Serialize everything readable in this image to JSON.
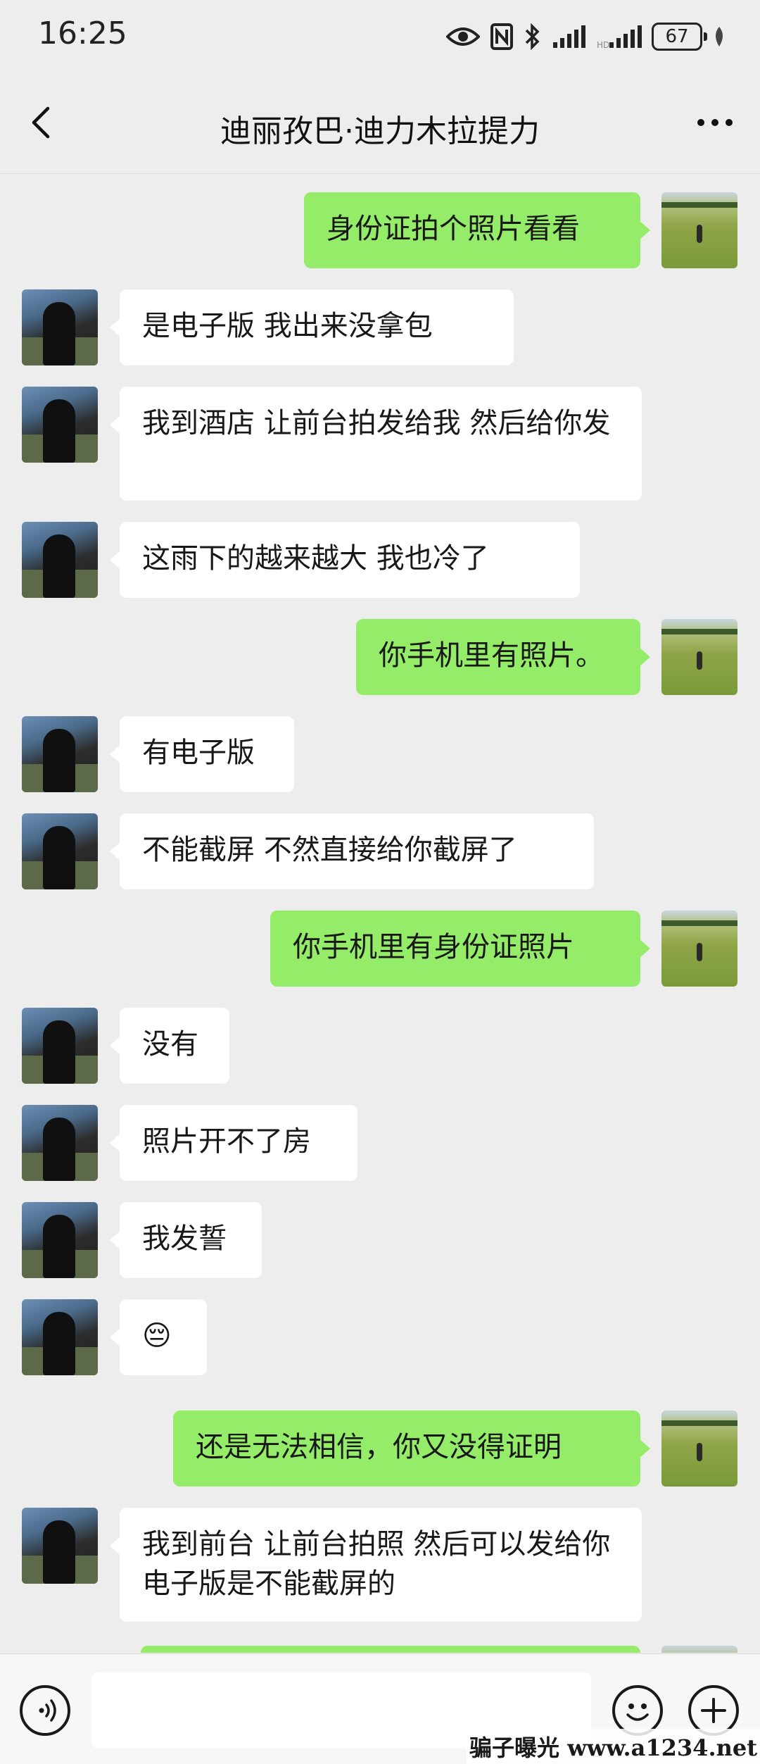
{
  "status_bar": {
    "time": "16:25",
    "battery": "67",
    "icons": [
      "eye-icon",
      "nfc-icon",
      "bluetooth-icon",
      "signal-icon",
      "signal-icon",
      "battery-icon",
      "leaf-icon"
    ]
  },
  "header": {
    "title": "迪丽孜巴·迪力木拉提力",
    "back_icon": "chevron-left-icon",
    "more_icon": "more-icon"
  },
  "messages": [
    {
      "side": "self",
      "text": "身份证拍个照片看看"
    },
    {
      "side": "other",
      "text": "是电子版  我出来没拿包"
    },
    {
      "side": "other",
      "text": "我到酒店 让前台拍发给我 然后给你发"
    },
    {
      "side": "other",
      "text": "这雨下的越来越大  我也冷了"
    },
    {
      "side": "self",
      "text": "你手机里有照片。"
    },
    {
      "side": "other",
      "text": "有电子版"
    },
    {
      "side": "other",
      "text": "不能截屏 不然直接给你截屏了"
    },
    {
      "side": "self",
      "text": "你手机里有身份证照片"
    },
    {
      "side": "other",
      "text": "没有"
    },
    {
      "side": "other",
      "text": "照片开不了房"
    },
    {
      "side": "other",
      "text": "我发誓"
    },
    {
      "side": "other",
      "text": "😔"
    },
    {
      "side": "self",
      "text": "还是无法相信，你又没得证明"
    },
    {
      "side": "other",
      "text": "我到前台 让前台拍照 然后可以发给你 电子版是不能截屏的"
    }
  ],
  "input_bar": {
    "placeholder": "",
    "voice_icon": "voice-icon",
    "emoji_icon": "emoji-icon",
    "plus_icon": "plus-icon"
  },
  "watermark": "骗子曝光 www.a1234.net",
  "colors": {
    "background": "#ededed",
    "self_bubble": "#95ec69",
    "other_bubble": "#ffffff"
  }
}
